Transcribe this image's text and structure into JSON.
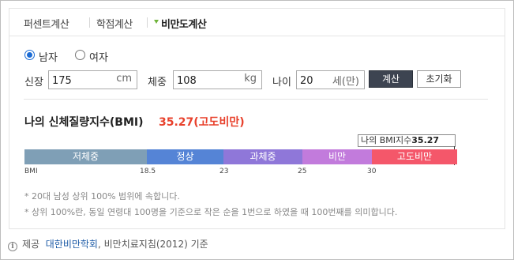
{
  "tabs": [
    {
      "label": "퍼센트계산"
    },
    {
      "label": "학점계산"
    },
    {
      "label": "비만도계산"
    }
  ],
  "form": {
    "gender": {
      "male_label": "남자",
      "female_label": "여자",
      "selected": "남자"
    },
    "height": {
      "label": "신장",
      "value": "175",
      "unit": "cm"
    },
    "weight": {
      "label": "체중",
      "value": "108",
      "unit": "kg"
    },
    "age": {
      "label": "나이",
      "value": "20",
      "unit": "세(만)"
    },
    "calc_button": "계산",
    "reset_button": "초기화"
  },
  "result": {
    "title": "나의 신체질량지수(BMI)",
    "value_text": "35.27(고도비만)",
    "callout_label": "나의 BMI지수",
    "callout_value": "35.27"
  },
  "scale": {
    "segments": [
      {
        "label": "저체중",
        "color": "#7f9fb6"
      },
      {
        "label": "정상",
        "color": "#5584d6"
      },
      {
        "label": "과체중",
        "color": "#8f77d9"
      },
      {
        "label": "비만",
        "color": "#c27bdc"
      },
      {
        "label": "고도비만",
        "color": "#f4576a"
      }
    ],
    "ticks": [
      "BMI",
      "18.5",
      "23",
      "25",
      "30"
    ]
  },
  "notes": [
    "* 20대 남성 상위 100% 범위에 속합니다.",
    "* 상위 100%란, 동일 연령대 100명을 기준으로 작은 순을 1번으로 하였을 때 100번째를 의미합니다."
  ],
  "footer": {
    "prefix": "제공",
    "link": "대한비만학회",
    "suffix": ", 비만치료지침(2012) 기준"
  }
}
